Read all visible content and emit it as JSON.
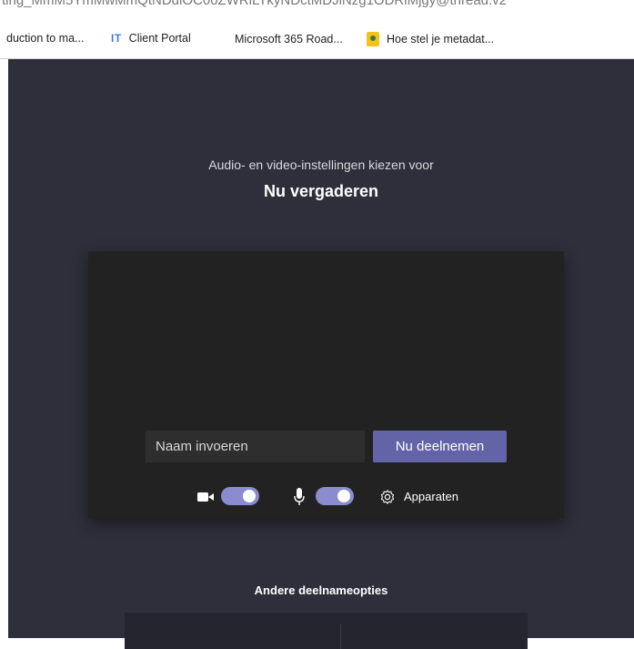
{
  "browser": {
    "url_fragment": "ting_MmM5YmMwMmQtNDdlOC00ZWRlLTkyNDctMDJlNzg1ODRiMjgy@thread.v2",
    "bookmarks": [
      {
        "label": "duction to ma...",
        "icon": "generic-page-icon"
      },
      {
        "label": "Client Portal",
        "icon": "it-logo-icon",
        "icon_text": "IT"
      },
      {
        "label": "Microsoft 365 Road...",
        "icon": "microsoft-logo-icon"
      },
      {
        "label": "Hoe stel je metadat...",
        "icon": "note-icon"
      }
    ]
  },
  "prejoin": {
    "subtitle": "Audio- en video-instellingen kiezen voor",
    "meeting_title": "Nu vergaderen",
    "name_placeholder": "Naam invoeren",
    "join_label": "Nu deelnemen",
    "camera_on": true,
    "mic_on": true,
    "devices_label": "Apparaten",
    "other_options_title": "Andere deelnameopties"
  },
  "colors": {
    "background": "#2f2f3b",
    "panel": "#222222",
    "accent": "#6264a7",
    "toggle_on": "#8b8ccf"
  }
}
